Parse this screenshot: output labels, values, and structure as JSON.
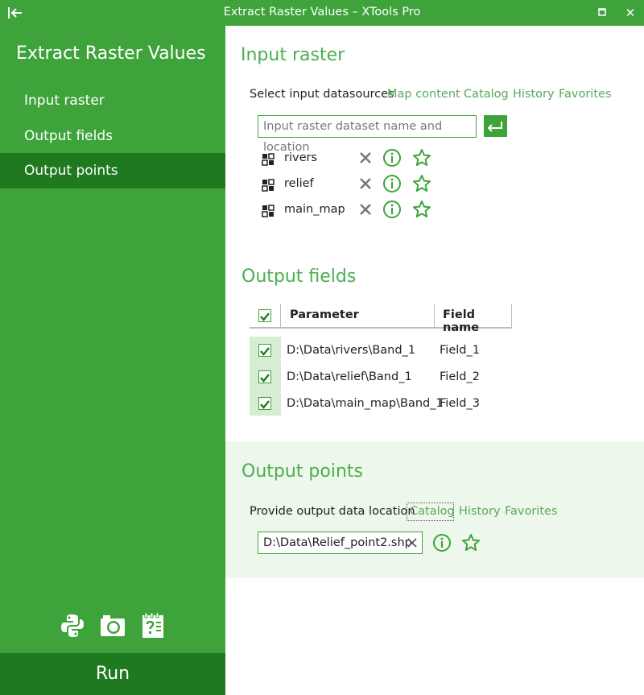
{
  "window": {
    "title": "Extract Raster Values – XTools Pro",
    "back_icon": "collapse-left-icon",
    "maximize_icon": "maximize-icon",
    "close_glyph": "✕"
  },
  "sidebar": {
    "app_title": "Extract Raster Values",
    "items": [
      {
        "label": "Input raster",
        "active": false
      },
      {
        "label": "Output fields",
        "active": false
      },
      {
        "label": "Output points",
        "active": true
      }
    ],
    "tools": [
      "python-icon",
      "camera-icon",
      "help-icon"
    ],
    "run_label": "Run"
  },
  "input_raster": {
    "title": "Input raster",
    "select_label": "Select input datasources",
    "source_links": [
      "Map content",
      "Catalog",
      "History",
      "Favorites"
    ],
    "input_placeholder": "Input raster dataset name and location",
    "datasets": [
      {
        "name": "rivers"
      },
      {
        "name": "relief"
      },
      {
        "name": "main_map"
      }
    ]
  },
  "output_fields": {
    "title": "Output fields",
    "columns": [
      "Parameter",
      "Field name"
    ],
    "rows": [
      {
        "parameter": "D:\\Data\\rivers\\Band_1",
        "field": "Field_1",
        "checked": true
      },
      {
        "parameter": "D:\\Data\\relief\\Band_1",
        "field": "Field_2",
        "checked": true
      },
      {
        "parameter": "D:\\Data\\main_map\\Band_1",
        "field": "Field_3",
        "checked": true
      }
    ]
  },
  "output_points": {
    "title": "Output points",
    "provide_label": "Provide output data location",
    "links": [
      "Catalog",
      "History",
      "Favorites"
    ],
    "path_value": "D:\\Data\\Relief_point2.shp"
  },
  "colors": {
    "accent": "#3ea33a",
    "accent_dark": "#1f7a1f",
    "section_title": "#4caf50",
    "link": "#5aa85a"
  }
}
